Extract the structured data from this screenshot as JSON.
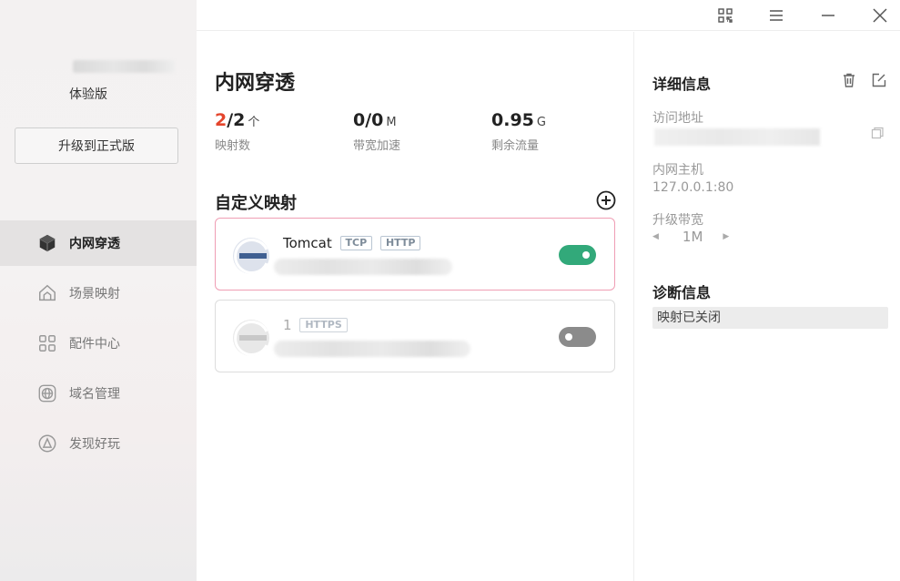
{
  "sidebar": {
    "edition": "体验版",
    "upgrade_label": "升级到正式版",
    "items": [
      {
        "label": "内网穿透",
        "icon": "cube-icon",
        "active": true
      },
      {
        "label": "场景映射",
        "icon": "house-icon",
        "active": false
      },
      {
        "label": "配件中心",
        "icon": "grid-icon",
        "active": false
      },
      {
        "label": "域名管理",
        "icon": "globe-icon",
        "active": false
      },
      {
        "label": "发现好玩",
        "icon": "discover-icon",
        "active": false
      }
    ]
  },
  "titlebar": {
    "icons": [
      "qrcode-icon",
      "menu-icon",
      "minimize-icon",
      "close-icon"
    ]
  },
  "main": {
    "title": "内网穿透",
    "stats": {
      "mappings": {
        "used": "2",
        "total": "/2",
        "unit": "个",
        "label": "映射数"
      },
      "bandwidth": {
        "value": "0/0",
        "unit": "M",
        "label": "带宽加速"
      },
      "traffic": {
        "value": "0.95",
        "unit": "G",
        "label": "剩余流量"
      }
    },
    "section_title": "自定义映射",
    "mappings": [
      {
        "name": "Tomcat",
        "tags": [
          "TCP",
          "HTTP"
        ],
        "enabled": true
      },
      {
        "name": "1",
        "tags": [
          "HTTPS"
        ],
        "enabled": false
      }
    ]
  },
  "detail": {
    "title": "详细信息",
    "address_label": "访问地址",
    "host_label": "内网主机",
    "host_value": "127.0.0.1:80",
    "bandwidth_label": "升级带宽",
    "bandwidth_value": "1M",
    "diag_title": "诊断信息",
    "diag_message": "映射已关闭"
  },
  "colors": {
    "accent_red": "#e4452c",
    "toggle_on": "#32a97a",
    "toggle_off": "#8b8b8b",
    "selected_border": "#ef9eb4"
  }
}
